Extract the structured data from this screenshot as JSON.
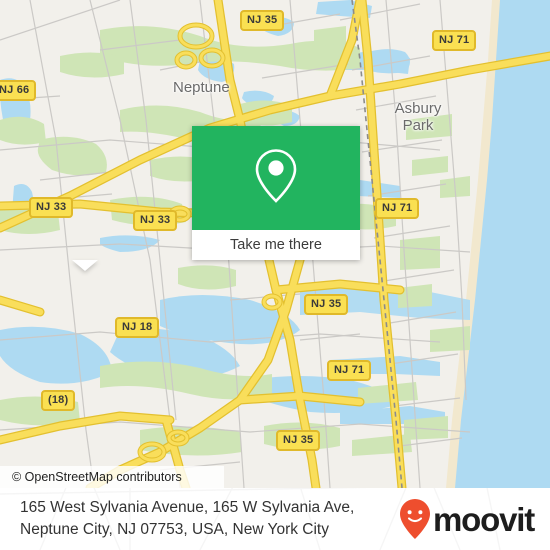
{
  "map": {
    "place_labels": [
      {
        "name": "Neptune",
        "lines": [
          "Neptune"
        ]
      },
      {
        "name": "Asbury Park",
        "lines": [
          "Asbury",
          "Park"
        ]
      }
    ],
    "route_shields": [
      {
        "label": "NJ 35"
      },
      {
        "label": "NJ 71"
      },
      {
        "label": "NJ 66"
      },
      {
        "label": "NJ 33"
      },
      {
        "label": "NJ 33"
      },
      {
        "label": "NJ 71"
      },
      {
        "label": "NJ 18"
      },
      {
        "label": "NJ 35"
      },
      {
        "label": "NJ 71"
      },
      {
        "label": "(18)"
      },
      {
        "label": "NJ 35"
      }
    ],
    "attribution": "© OpenStreetMap contributors",
    "colors": {
      "land": "#F2F0EB",
      "water": "#AEDAF2",
      "park": "#CFE5B6",
      "sand": "#F2E8CE",
      "highway": "#F7D94C",
      "shield_fill": "#FAE052"
    }
  },
  "card": {
    "icon": "map-pin-icon",
    "label": "Take me there",
    "accent_color": "#22B45F"
  },
  "footer": {
    "address": "165 West Sylvania Avenue, 165 W Sylvania Ave, Neptune City, NJ 07753, USA, New York City",
    "brand_name": "moovit",
    "brand_icon": "moovit-pin-smiley-icon",
    "brand_color": "#EE4E2E"
  }
}
